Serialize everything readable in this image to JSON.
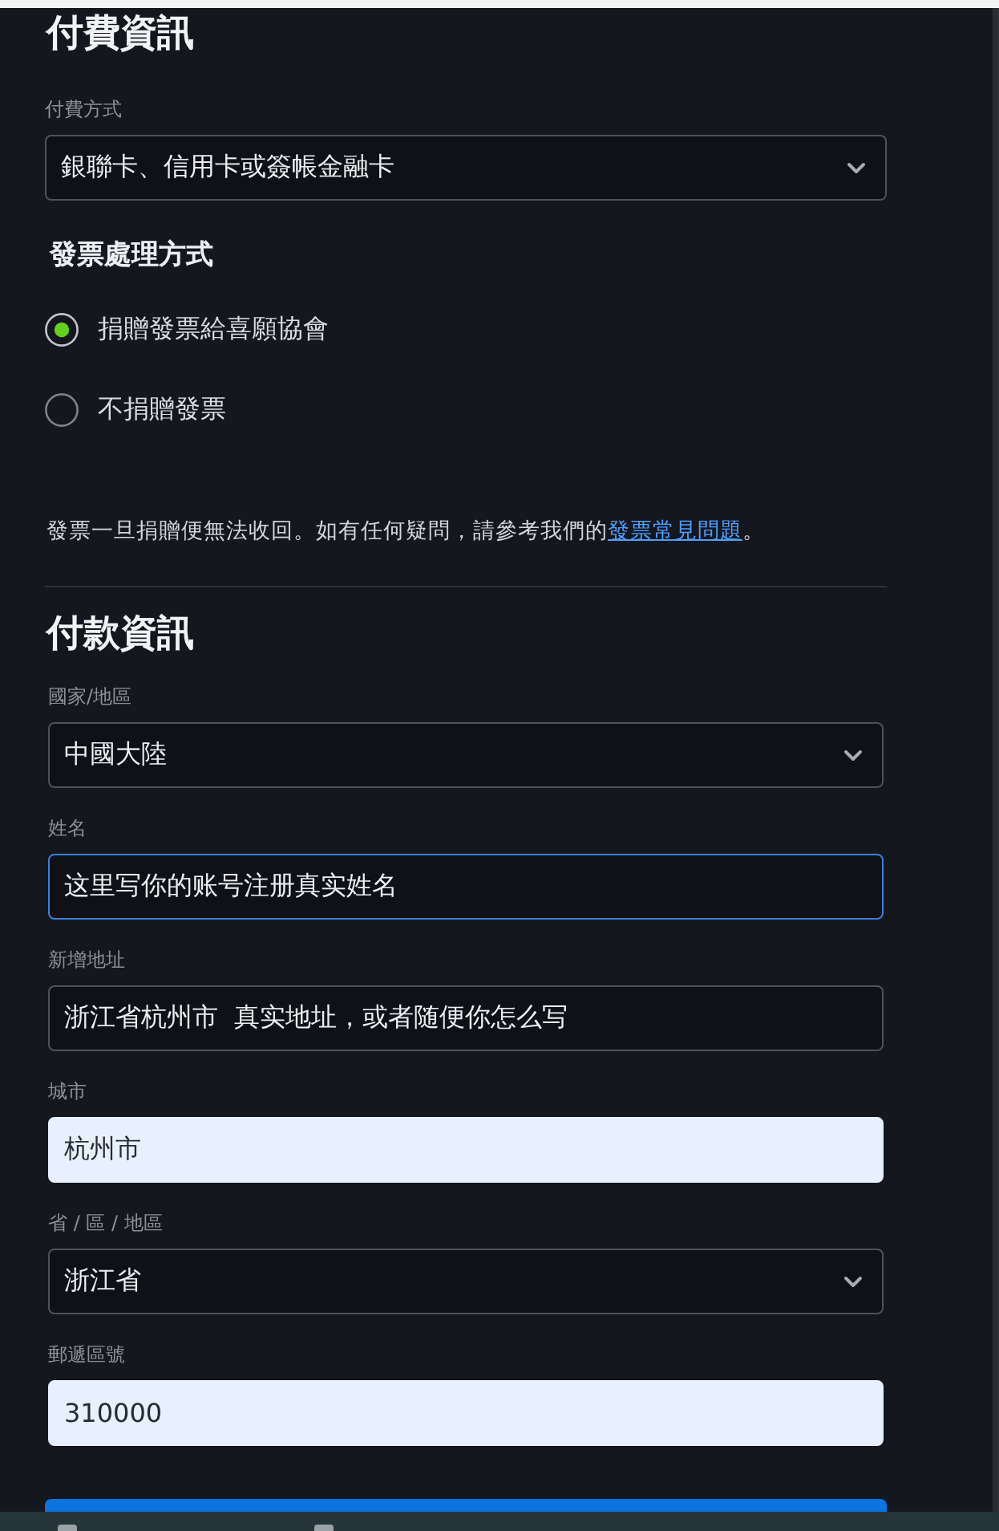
{
  "billing": {
    "title": "付費資訊",
    "payment_method": {
      "kind": "select",
      "label": "付費方式",
      "value": "銀聯卡、信用卡或簽帳金融卡",
      "focused": false,
      "autofilled": false
    },
    "invoice": {
      "title": "發票處理方式",
      "options": [
        {
          "label": "捐贈發票給喜願協會",
          "selected": true
        },
        {
          "label": "不捐贈發票",
          "selected": false
        }
      ],
      "note": {
        "text": "發票一旦捐贈便無法收回。如有任何疑問，請參考我們的",
        "link": "發票常見問題",
        "suffix": "。"
      }
    }
  },
  "payment": {
    "title": "付款資訊",
    "fields": [
      {
        "kind": "select",
        "label": "國家/地區",
        "value": "中國大陸",
        "focused": false,
        "autofilled": false
      },
      {
        "kind": "text",
        "label": "姓名",
        "value": "这里写你的账号注册真实姓名",
        "focused": true,
        "autofilled": false
      },
      {
        "kind": "text",
        "label": "新增地址",
        "value": "浙江省杭州市  真实地址，或者随便你怎么写",
        "focused": false,
        "autofilled": false
      },
      {
        "kind": "text",
        "label": "城市",
        "value": "杭州市",
        "focused": false,
        "autofilled": true
      },
      {
        "kind": "select",
        "label": "省 / 區 / 地區",
        "value": "浙江省",
        "focused": false,
        "autofilled": false
      },
      {
        "kind": "text",
        "label": "郵遞區號",
        "value": "310000",
        "focused": false,
        "autofilled": true
      }
    ]
  }
}
